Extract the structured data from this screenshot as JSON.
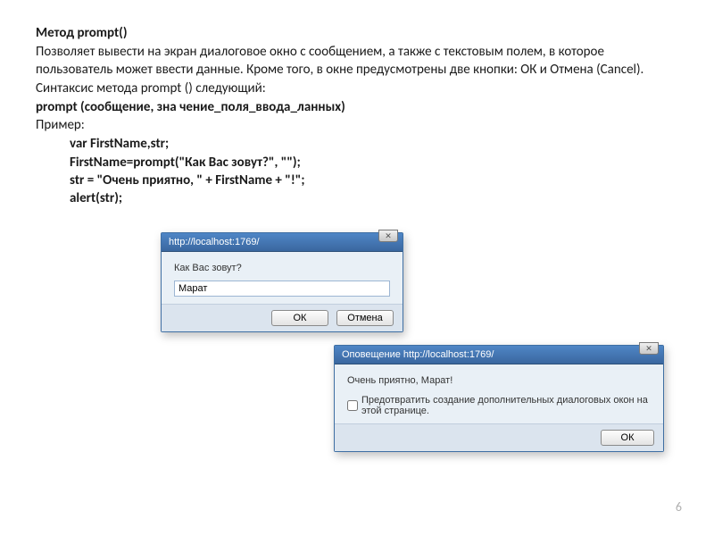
{
  "heading": "Метод prompt()",
  "p1": "Позволяет вывести на экран диалоговое окно с сообщением, а также с текстовым полем, в которое пользователь может ввести данные. Кроме того, в окне предусмотрены две кнопки: ОК и Отмена (Cancel). Синтаксис метода prompt () следующий:",
  "syntax": "prompt (сообщение, зна чение_поля_ввода_ланных)",
  "example_label": "Пример:",
  "code1": "var FirstName,str;",
  "code2": "FirstName=prompt(\"Как Вас зовут?\", \"\");",
  "code3": "str = \"Очень приятно, \" + FirstName + \"!\";",
  "code4": "alert(str);",
  "dialog1": {
    "title": "http://localhost:1769/",
    "message": "Как Вас зовут?",
    "input_value": "Марат",
    "ok": "ОК",
    "cancel": "Отмена"
  },
  "dialog2": {
    "title": "Оповещение http://localhost:1769/",
    "message": "Очень приятно, Марат!",
    "checkbox_label": "Предотвратить создание дополнительных диалоговых окон на этой странице.",
    "ok": "ОК"
  },
  "page_number": "6"
}
